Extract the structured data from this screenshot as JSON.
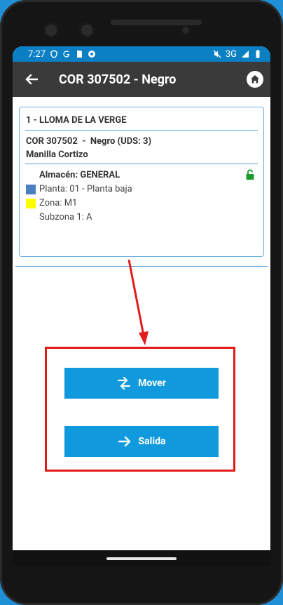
{
  "status_bar": {
    "time": "7:27",
    "network": "3G"
  },
  "app_bar": {
    "title": "COR 307502 - Negro"
  },
  "card": {
    "heading": "1 - LLOMA DE LA VERGE",
    "product_line": "COR 307502  -  Negro (UDS: 3)",
    "product_name": "Manilla Cortizo",
    "almacen": "Almacén: GENERAL",
    "planta": "Planta: 01 - Planta baja",
    "zona": "Zona: M1",
    "subzona": "Subzona 1: A",
    "planta_color": "#4a7fc1",
    "zona_color": "#ffff00",
    "lock_color": "#1a9b2a"
  },
  "actions": {
    "mover_label": "Mover",
    "salida_label": "Salida",
    "button_color": "#1199dd",
    "highlight_color": "#e31b1b"
  }
}
